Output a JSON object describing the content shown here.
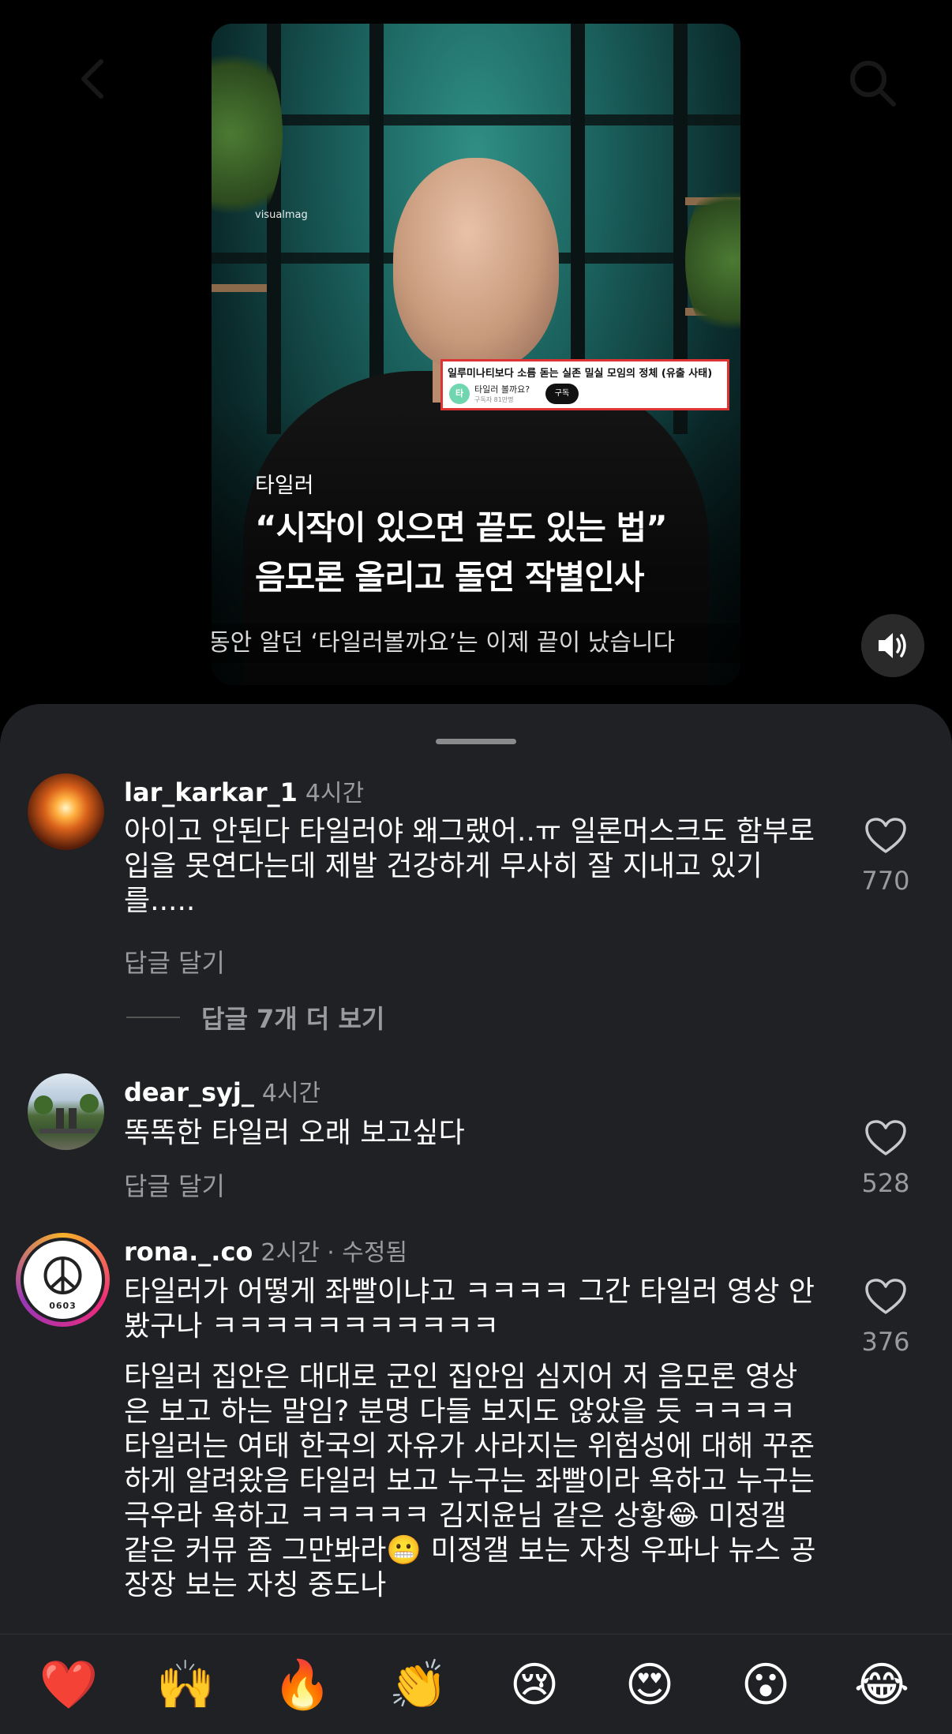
{
  "video": {
    "watermark": "visualmag",
    "overlay_card": {
      "title": "일루미나티보다 소름 돋는 실존 밀실 모임의 정체 (유출 사태)",
      "avatar_text": "타",
      "channel_name": "타일러 볼까요?",
      "subscribers": "구독자 81만명",
      "subscribe_label": "구독"
    },
    "channel_label": "타일러",
    "headline_line1": "“시작이 있으면 끝도 있는 법”",
    "headline_line2": "음모론 올리고 돌연 작별인사",
    "subtitle": "동안 알던 ‘타일러볼까요’는 이제 끝이 났습니다",
    "sound_icon": "speaker-icon"
  },
  "comments": [
    {
      "username": "lar_karkar_1",
      "time": "4시간",
      "text": "아이고 안된다 타일러야 왜그랬어..ㅠ 일론머스크도 함부로 입을 못연다는데 제발 건강하게 무사히 잘 지내고 있기를.....",
      "reply_label": "답글 달기",
      "likes": "770",
      "more_replies": "답글 7개 더 보기"
    },
    {
      "username": "dear_syj_",
      "time": "4시간",
      "text": "똑똑한 타일러 오래 보고싶다",
      "reply_label": "답글 달기",
      "likes": "528"
    },
    {
      "username": "rona._.co",
      "time": "2시간 · 수정됨",
      "text": "타일러가 어떻게 좌빨이냐고 ㅋㅋㅋㅋ 그간 타일러 영상 안봤구나 ㅋㅋㅋㅋㅋㅋㅋㅋㅋㅋㅋ",
      "text2": "타일러 집안은 대대로 군인 집안임 심지어 저 음모론 영상은 보고 하는 말임? 분명 다들 보지도 않았을 듯 ㅋㅋㅋㅋ 타일러는 여태 한국의 자유가 사라지는 위험성에 대해 꾸준하게 알려왔음 타일러 보고 누구는 좌빨이라 욕하고 누구는 극우라 욕하고 ㅋㅋㅋㅋㅋ 김지윤님 같은 상황😂 미정갤 같은 커뮤 좀 그만봐라😬 미정갤 보는 자칭 우파나 뉴스 공장장 보는 자칭 중도나",
      "likes": "376",
      "avatar_text": "0603"
    }
  ],
  "emoji_bar": [
    "❤️",
    "🙌",
    "🔥",
    "👏",
    "😢",
    "😍",
    "😮",
    "😂"
  ]
}
